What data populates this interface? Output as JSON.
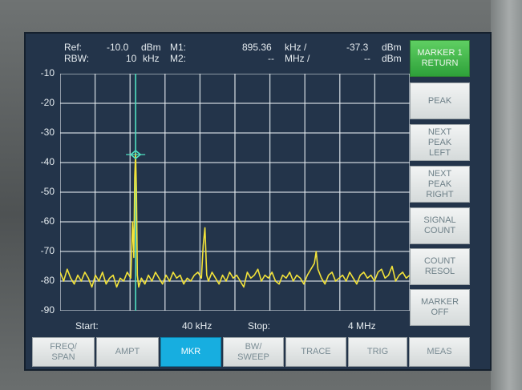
{
  "header": {
    "ref_label": "Ref:",
    "ref_value": "-10.0",
    "ref_unit": "dBm",
    "rbw_label": "RBW:",
    "rbw_value": "10",
    "rbw_unit": "kHz",
    "m1_label": "M1:",
    "m1_freq": "895.36",
    "m1_freq_unit": "kHz /",
    "m1_level": "-37.3",
    "m1_level_unit": "dBm",
    "m2_label": "M2:",
    "m2_freq": "--",
    "m2_freq_unit": "MHz /",
    "m2_level": "--",
    "m2_level_unit": "dBm"
  },
  "footer": {
    "start_label": "Start:",
    "start_value": "40 kHz",
    "stop_label": "Stop:",
    "stop_value": "4 MHz"
  },
  "softkeys": [
    {
      "label": "MARKER 1\nRETURN",
      "active": true
    },
    {
      "label": "PEAK",
      "active": false
    },
    {
      "label": "NEXT\nPEAK\nLEFT",
      "active": false
    },
    {
      "label": "NEXT\nPEAK\nRIGHT",
      "active": false
    },
    {
      "label": "SIGNAL\nCOUNT",
      "active": false
    },
    {
      "label": "COUNT\nRESOL",
      "active": false
    },
    {
      "label": "MARKER\nOFF",
      "active": false
    }
  ],
  "tabs": [
    {
      "label": "FREQ/\nSPAN",
      "active": false
    },
    {
      "label": "AMPT",
      "active": false
    },
    {
      "label": "MKR",
      "active": true
    },
    {
      "label": "BW/\nSWEEP",
      "active": false
    },
    {
      "label": "TRACE",
      "active": false
    },
    {
      "label": "TRIG",
      "active": false
    },
    {
      "label": "MEAS",
      "active": false
    }
  ],
  "colors": {
    "trace": "#f2e23a",
    "marker": "#4fe0c0",
    "grid": "#e8eef2",
    "screen_bg": "#23344a",
    "active_softkey": "#3cbc45",
    "active_tab": "#17aee0"
  },
  "chart_data": {
    "type": "line",
    "title": "",
    "xlabel": "",
    "ylabel": "",
    "ylim": [
      -90,
      -10
    ],
    "xlim": [
      0.04,
      4.0
    ],
    "x_unit": "MHz",
    "y_unit": "dBm",
    "grid": true,
    "y_ticks": [
      "-10",
      "-20",
      "-30",
      "-40",
      "-50",
      "-60",
      "-70",
      "-80",
      "-90"
    ],
    "marker": {
      "name": "M1",
      "x": 0.895,
      "y": -37.3
    },
    "series": [
      {
        "x": [
          0.04,
          0.08,
          0.12,
          0.16,
          0.2,
          0.24,
          0.28,
          0.32,
          0.36,
          0.4,
          0.44,
          0.48,
          0.52,
          0.56,
          0.6,
          0.64,
          0.68,
          0.72,
          0.76,
          0.8,
          0.84,
          0.86,
          0.875,
          0.885,
          0.895,
          0.905,
          0.915,
          0.93,
          0.96,
          1.0,
          1.04,
          1.08,
          1.12,
          1.16,
          1.2,
          1.24,
          1.28,
          1.32,
          1.36,
          1.4,
          1.44,
          1.48,
          1.52,
          1.56,
          1.6,
          1.64,
          1.66,
          1.68,
          1.7,
          1.72,
          1.76,
          1.8,
          1.84,
          1.88,
          1.92,
          1.96,
          2.0,
          2.04,
          2.08,
          2.12,
          2.16,
          2.2,
          2.24,
          2.28,
          2.32,
          2.36,
          2.4,
          2.44,
          2.48,
          2.52,
          2.56,
          2.6,
          2.64,
          2.68,
          2.72,
          2.76,
          2.8,
          2.84,
          2.88,
          2.92,
          2.94,
          2.96,
          3.0,
          3.04,
          3.08,
          3.12,
          3.16,
          3.2,
          3.24,
          3.28,
          3.32,
          3.36,
          3.4,
          3.44,
          3.48,
          3.52,
          3.56,
          3.6,
          3.64,
          3.68,
          3.72,
          3.76,
          3.8,
          3.84,
          3.88,
          3.92,
          3.96,
          4.0
        ],
        "y": [
          -77,
          -80,
          -76,
          -79,
          -81,
          -78,
          -80,
          -77,
          -79,
          -82,
          -78,
          -80,
          -77,
          -81,
          -79,
          -78,
          -82,
          -79,
          -80,
          -77,
          -79,
          -60,
          -72,
          -45,
          -37,
          -50,
          -78,
          -82,
          -79,
          -81,
          -78,
          -80,
          -77,
          -79,
          -81,
          -78,
          -80,
          -77,
          -79,
          -78,
          -81,
          -79,
          -80,
          -78,
          -77,
          -79,
          -68,
          -62,
          -78,
          -80,
          -77,
          -79,
          -81,
          -78,
          -80,
          -77,
          -79,
          -78,
          -80,
          -82,
          -77,
          -79,
          -78,
          -76,
          -80,
          -78,
          -79,
          -77,
          -80,
          -81,
          -78,
          -79,
          -77,
          -80,
          -78,
          -79,
          -81,
          -78,
          -76,
          -74,
          -70,
          -76,
          -79,
          -81,
          -78,
          -77,
          -80,
          -79,
          -78,
          -80,
          -77,
          -79,
          -81,
          -78,
          -77,
          -79,
          -78,
          -80,
          -77,
          -76,
          -79,
          -78,
          -75,
          -80,
          -78,
          -77,
          -79,
          -78
        ]
      }
    ]
  }
}
